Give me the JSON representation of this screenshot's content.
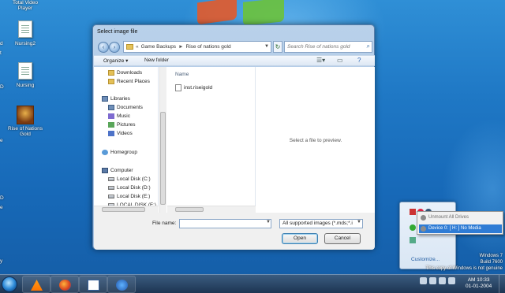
{
  "desktop": {
    "icons": [
      {
        "label": "Total Video Player",
        "kind": "doc"
      },
      {
        "label": "Nursing2",
        "kind": "doc"
      },
      {
        "label": "Nursing",
        "kind": "doc"
      },
      {
        "label": "Rise of Nations Gold",
        "kind": "game"
      }
    ],
    "left_fragments": [
      "d",
      "t",
      "D",
      "e",
      "D",
      "e",
      "y"
    ]
  },
  "dialog": {
    "title": "Select image file",
    "breadcrumb": [
      "«",
      "Game Backups",
      "►",
      "Rise of nations gold"
    ],
    "search_placeholder": "Search Rise of nations gold",
    "toolbar": {
      "organize": "Organize ▾",
      "new_folder": "New folder"
    },
    "nav": {
      "items": [
        {
          "label": "Downloads",
          "icon": "folder-icon",
          "indent": "sub"
        },
        {
          "label": "Recent Places",
          "icon": "folder-icon",
          "indent": "sub"
        },
        {
          "label": "Libraries",
          "icon": "library-icon",
          "indent": "group"
        },
        {
          "label": "Documents",
          "icon": "library-icon",
          "indent": "sub"
        },
        {
          "label": "Music",
          "icon": "music-icon",
          "indent": "sub"
        },
        {
          "label": "Pictures",
          "icon": "pictures-icon",
          "indent": "sub"
        },
        {
          "label": "Videos",
          "icon": "videos-icon",
          "indent": "sub"
        },
        {
          "label": "Homegroup",
          "icon": "homegroup-icon",
          "indent": "group"
        },
        {
          "label": "Computer",
          "icon": "computer-icon",
          "indent": "group"
        },
        {
          "label": "Local Disk (C:)",
          "icon": "disk-icon",
          "indent": "sub"
        },
        {
          "label": "Local Disk (D:)",
          "icon": "disk-icon",
          "indent": "sub"
        },
        {
          "label": "Local Disk (E:)",
          "icon": "disk-icon",
          "indent": "sub"
        },
        {
          "label": "LOCAL DISK (F:)",
          "icon": "disk-icon",
          "indent": "sub"
        }
      ]
    },
    "files": {
      "column_name": "Name",
      "items": [
        "inst.riseigold"
      ]
    },
    "preview_text": "Select a file to preview.",
    "file_name_label": "File name:",
    "file_name_value": "",
    "file_type_selected": "All supported images (*.mds;*.i",
    "open_label": "Open",
    "cancel_label": "Cancel"
  },
  "tray_popup": {
    "menu": {
      "item_unmount": "Unmount All Drives",
      "item_device": "Device 0: [ H: ] No Media"
    },
    "customize_label": "Customize..."
  },
  "watermark": {
    "line1": "Windows 7",
    "line2": "Build 7600",
    "line3": "This copy of Windows is not genuine"
  },
  "taskbar": {
    "apps": [
      "vlc-icon",
      "firefox-icon",
      "word-icon",
      "daemon-tools-icon"
    ],
    "clock_time": "AM 10:33",
    "clock_date": "01-01-2004"
  }
}
